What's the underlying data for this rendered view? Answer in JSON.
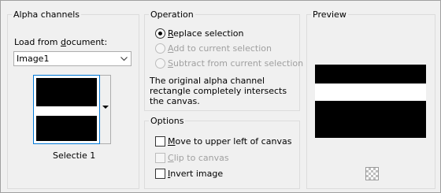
{
  "alpha_channels": {
    "title": "Alpha channels",
    "load_label_prefix": "Load from ",
    "load_label_accel": "d",
    "load_label_suffix": "ocument:",
    "document_value": "Image1",
    "channel_name": "Selectie 1"
  },
  "operation": {
    "title": "Operation",
    "options": [
      {
        "accel": "R",
        "rest": "eplace selection",
        "selected": true,
        "enabled": true
      },
      {
        "accel": "A",
        "rest": "dd to current selection",
        "selected": false,
        "enabled": false
      },
      {
        "accel": "S",
        "rest": "ubtract from current selection",
        "selected": false,
        "enabled": false
      }
    ],
    "message": "The original alpha channel rectangle completely intersects the canvas."
  },
  "options": {
    "title": "Options",
    "items": [
      {
        "accel": "M",
        "rest": "ove to upper left of canvas",
        "checked": false,
        "enabled": true
      },
      {
        "accel": "C",
        "rest": "lip to canvas",
        "checked": false,
        "enabled": false
      },
      {
        "accel": "I",
        "rest": "nvert image",
        "checked": false,
        "enabled": true
      }
    ]
  },
  "preview": {
    "title": "Preview"
  },
  "icons": [
    "chevron-down-icon",
    "dropdown-arrow-icon",
    "transparency-checker-icon"
  ]
}
